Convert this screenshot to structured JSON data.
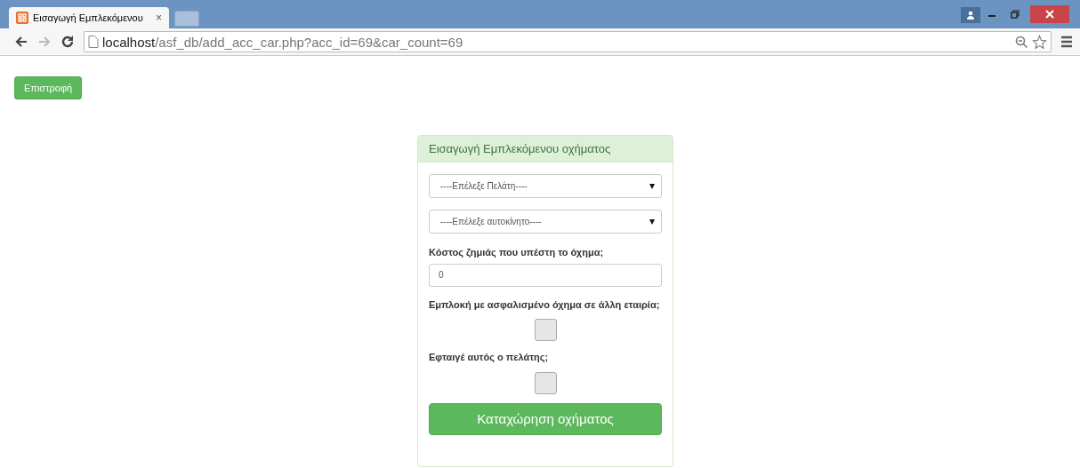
{
  "browser": {
    "tab": {
      "title": "Εισαγωγή Εμπλεκόμενου",
      "close": "×"
    },
    "url_host": "localhost",
    "url_path": "/asf_db/add_acc_car.php?acc_id=69&car_count=69"
  },
  "back_button": "Επιστροφή",
  "panel": {
    "title": "Εισαγωγή Εμπλεκόμενου οχήματος",
    "selects": [
      {
        "value": "----Επέλεξε Πελάτη----"
      },
      {
        "value": "----Επέλεξε αυτοκίνητο----"
      }
    ],
    "cost": {
      "label": "Κόστος ζημιάς που υπέστη το όχημα;",
      "value": "0"
    },
    "checkboxes": [
      {
        "label": "Εμπλοκή με ασφαλισμένο όχημα σε άλλη εταιρία;",
        "checked": false
      },
      {
        "label": "Εφταιγέ αυτός ο πελάτης;",
        "checked": false
      }
    ],
    "submit": "Καταχώρηση οχήματος"
  }
}
